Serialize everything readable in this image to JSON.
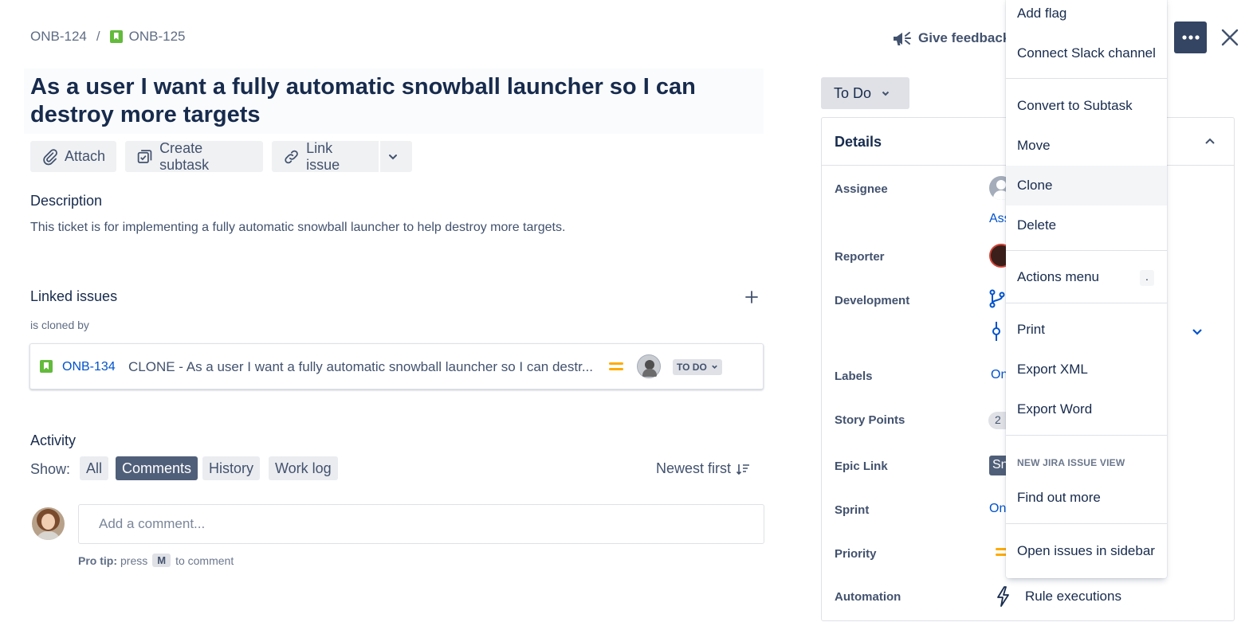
{
  "breadcrumb": {
    "parent": "ONB-124",
    "separator": "/",
    "current": "ONB-125"
  },
  "issue": {
    "title": "As a user I want a fully automatic snowball launcher so I can destroy more targets"
  },
  "toolbar": {
    "attach": "Attach",
    "create_subtask": "Create subtask",
    "link_issue": "Link issue"
  },
  "description": {
    "heading": "Description",
    "text": "This ticket is for implementing a fully automatic snowball launcher to help destroy more targets."
  },
  "linked_issues": {
    "heading": "Linked issues",
    "relation": "is cloned by",
    "items": [
      {
        "key": "ONB-134",
        "summary": "CLONE - As a user I want a fully automatic snowball launcher so I can destr...",
        "status": "TO DO"
      }
    ]
  },
  "activity": {
    "heading": "Activity",
    "show_label": "Show:",
    "filters": [
      "All",
      "Comments",
      "History",
      "Work log"
    ],
    "active_filter": "Comments",
    "sort": "Newest first",
    "comment_placeholder": "Add a comment...",
    "protip_bold": "Pro tip:",
    "protip_press": "press",
    "protip_key": "M",
    "protip_end": "to comment"
  },
  "header": {
    "give_feedback": "Give feedback"
  },
  "status": {
    "label": "To Do"
  },
  "details": {
    "heading": "Details",
    "fields": {
      "assignee": "Assignee",
      "reporter": "Reporter",
      "development": "Development",
      "labels": "Labels",
      "story_points": "Story Points",
      "epic_link": "Epic Link",
      "sprint": "Sprint",
      "priority": "Priority",
      "automation": "Automation"
    },
    "values": {
      "assignee_partial": "Ass",
      "labels_partial": "On",
      "story_points_partial": "2",
      "epic_partial": "Sn",
      "sprint_partial": "On",
      "automation": "Rule executions"
    }
  },
  "menu": {
    "items": {
      "add_flag": "Add flag",
      "connect_slack": "Connect Slack channel",
      "convert_subtask": "Convert to Subtask",
      "move": "Move",
      "clone": "Clone",
      "delete": "Delete",
      "actions_menu": "Actions menu",
      "actions_shortcut": ".",
      "print": "Print",
      "export_xml": "Export XML",
      "export_word": "Export Word",
      "group_heading": "NEW JIRA ISSUE VIEW",
      "find_out_more": "Find out more",
      "open_sidebar": "Open issues in sidebar"
    }
  },
  "colors": {
    "story_green": "#63ba3c",
    "link_blue": "#0052cc",
    "priority_medium": "#ffab00",
    "active_chip": "#505f79",
    "more_button": "#344563"
  }
}
